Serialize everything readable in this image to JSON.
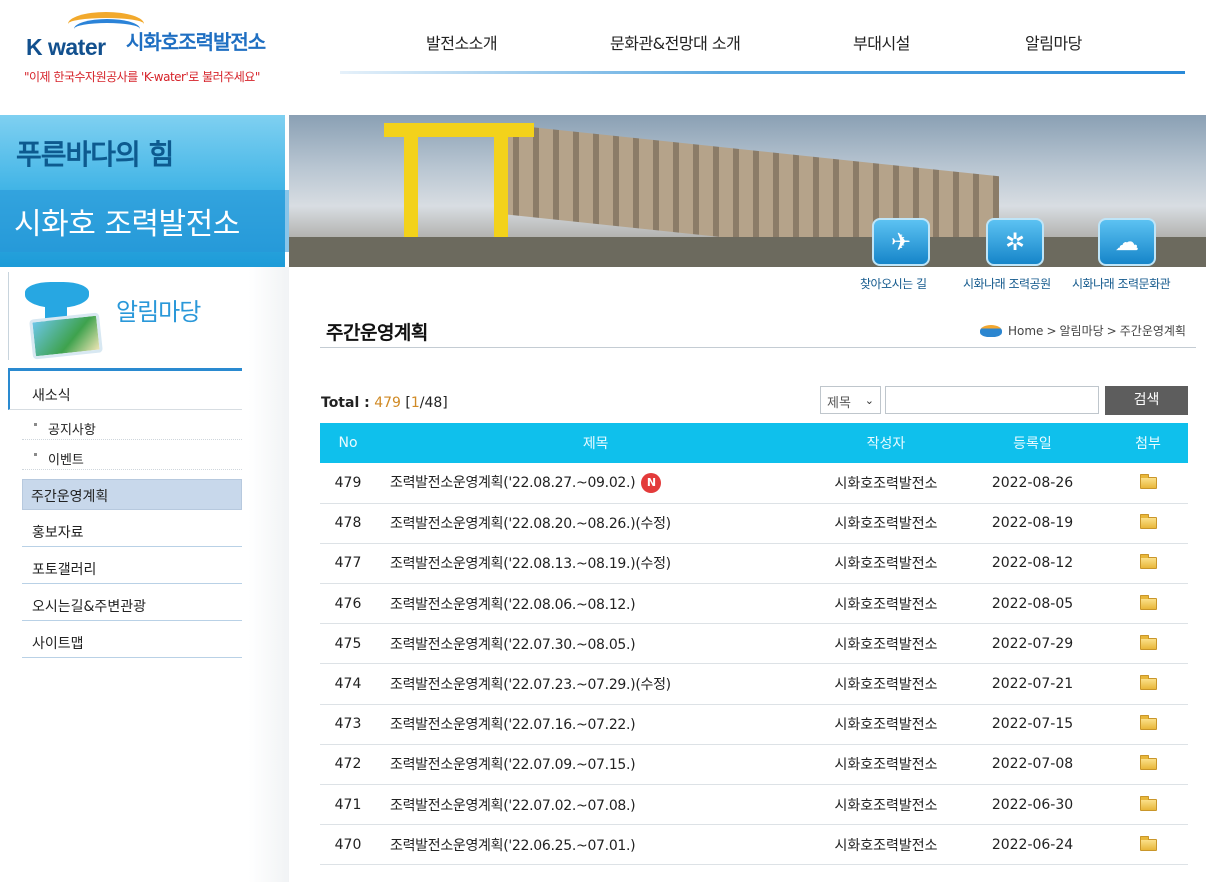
{
  "header": {
    "logo_brand": "K water",
    "logo_name": "시화호조력발전소",
    "slogan": "\"이제 한국수자원공사를 'K-water'로 불러주세요\"",
    "nav": [
      "발전소소개",
      "문화관&전망대 소개",
      "부대시설",
      "알림마당"
    ]
  },
  "visual": {
    "line1": "푸른바다의 힘",
    "line2": "시화호 조력발전소"
  },
  "quick_links": [
    "찾아오시는 길",
    "시화나래 조력공원",
    "시화나래 조력문화관"
  ],
  "sidebar": {
    "title": "알림마당",
    "menu": {
      "news": "새소식",
      "sub": [
        "공지사항",
        "이벤트"
      ],
      "active": "주간운영계획",
      "items": [
        "홍보자료",
        "포토갤러리",
        "오시는길&주변관광",
        "사이트맵"
      ]
    }
  },
  "content": {
    "title": "주간운영계획",
    "breadcrumb": [
      "Home",
      "알림마당",
      "주간운영계획"
    ],
    "total_label": "Total :",
    "total": "479",
    "page_current": "1",
    "page_total": "/48",
    "search": {
      "select_value": "제목",
      "button": "검색"
    },
    "columns": [
      "No",
      "제목",
      "작성자",
      "등록일",
      "첨부"
    ],
    "new_badge": "N",
    "rows": [
      {
        "no": "479",
        "title": "조력발전소운영계획('22.08.27.~09.02.)",
        "writer": "시화호조력발전소",
        "date": "2022-08-26"
      },
      {
        "no": "478",
        "title": "조력발전소운영계획('22.08.20.~08.26.)(수정)",
        "writer": "시화호조력발전소",
        "date": "2022-08-19"
      },
      {
        "no": "477",
        "title": "조력발전소운영계획('22.08.13.~08.19.)(수정)",
        "writer": "시화호조력발전소",
        "date": "2022-08-12"
      },
      {
        "no": "476",
        "title": "조력발전소운영계획('22.08.06.~08.12.)",
        "writer": "시화호조력발전소",
        "date": "2022-08-05"
      },
      {
        "no": "475",
        "title": "조력발전소운영계획('22.07.30.~08.05.)",
        "writer": "시화호조력발전소",
        "date": "2022-07-29"
      },
      {
        "no": "474",
        "title": "조력발전소운영계획('22.07.23.~07.29.)(수정)",
        "writer": "시화호조력발전소",
        "date": "2022-07-21"
      },
      {
        "no": "473",
        "title": "조력발전소운영계획('22.07.16.~07.22.)",
        "writer": "시화호조력발전소",
        "date": "2022-07-15"
      },
      {
        "no": "472",
        "title": "조력발전소운영계획('22.07.09.~07.15.)",
        "writer": "시화호조력발전소",
        "date": "2022-07-08"
      },
      {
        "no": "471",
        "title": "조력발전소운영계획('22.07.02.~07.08.)",
        "writer": "시화호조력발전소",
        "date": "2022-06-30"
      },
      {
        "no": "470",
        "title": "조력발전소운영계획('22.06.25.~07.01.)",
        "writer": "시화호조력발전소",
        "date": "2022-06-24"
      }
    ]
  },
  "colors": {
    "accent": "#0fc0ec",
    "brand": "#1f6fc2",
    "slogan": "#d6232a"
  }
}
